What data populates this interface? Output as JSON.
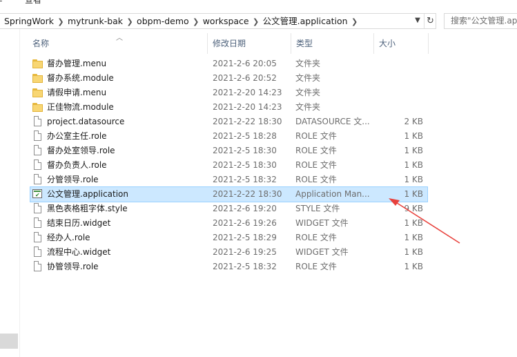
{
  "menu": {
    "left_partial": "查看",
    "left_edge": "E"
  },
  "address_bar": {
    "crumbs": [
      "SpringWork",
      "mytrunk-bak",
      "obpm-demo",
      "workspace",
      "公文管理.application"
    ],
    "dropdown_icon": "chevron-down-icon",
    "refresh_icon": "refresh-icon"
  },
  "search": {
    "placeholder": "搜索\"公文管理.ap"
  },
  "columns": {
    "name": "名称",
    "date": "修改日期",
    "type": "类型",
    "size": "大小"
  },
  "files": [
    {
      "name": "督办管理.menu",
      "date": "2021-2-6 20:05",
      "type": "文件夹",
      "size": "",
      "icon": "folder-icon"
    },
    {
      "name": "督办系统.module",
      "date": "2021-2-6 20:52",
      "type": "文件夹",
      "size": "",
      "icon": "folder-icon"
    },
    {
      "name": "请假申请.menu",
      "date": "2021-2-20 14:23",
      "type": "文件夹",
      "size": "",
      "icon": "folder-icon"
    },
    {
      "name": "正佳物流.module",
      "date": "2021-2-20 14:23",
      "type": "文件夹",
      "size": "",
      "icon": "folder-icon"
    },
    {
      "name": "project.datasource",
      "date": "2021-2-22 18:30",
      "type": "DATASOURCE 文...",
      "size": "2 KB",
      "icon": "file-icon"
    },
    {
      "name": "办公室主任.role",
      "date": "2021-2-5 18:28",
      "type": "ROLE 文件",
      "size": "1 KB",
      "icon": "file-icon"
    },
    {
      "name": "督办处室领导.role",
      "date": "2021-2-5 18:30",
      "type": "ROLE 文件",
      "size": "1 KB",
      "icon": "file-icon"
    },
    {
      "name": "督办负责人.role",
      "date": "2021-2-5 18:30",
      "type": "ROLE 文件",
      "size": "1 KB",
      "icon": "file-icon"
    },
    {
      "name": "分管领导.role",
      "date": "2021-2-5 18:32",
      "type": "ROLE 文件",
      "size": "1 KB",
      "icon": "file-icon"
    },
    {
      "name": "公文管理.application",
      "date": "2021-2-22 18:30",
      "type": "Application Man...",
      "size": "1 KB",
      "icon": "application-icon",
      "selected": true
    },
    {
      "name": "黑色表格粗字体.style",
      "date": "2021-2-6 19:20",
      "type": "STYLE 文件",
      "size": "9 KB",
      "icon": "file-icon"
    },
    {
      "name": "结束日历.widget",
      "date": "2021-2-6 19:26",
      "type": "WIDGET 文件",
      "size": "1 KB",
      "icon": "file-icon"
    },
    {
      "name": "经办人.role",
      "date": "2021-2-5 18:29",
      "type": "ROLE 文件",
      "size": "1 KB",
      "icon": "file-icon"
    },
    {
      "name": "流程中心.widget",
      "date": "2021-2-6 19:25",
      "type": "WIDGET 文件",
      "size": "1 KB",
      "icon": "file-icon"
    },
    {
      "name": "协管领导.role",
      "date": "2021-2-5 18:32",
      "type": "ROLE 文件",
      "size": "1 KB",
      "icon": "file-icon"
    }
  ],
  "colors": {
    "selection": "#cce8ff",
    "selection_border": "#99d1ff",
    "header_text": "#4c607a",
    "annotation_arrow": "#e8413c",
    "folder": "#f8d673"
  }
}
